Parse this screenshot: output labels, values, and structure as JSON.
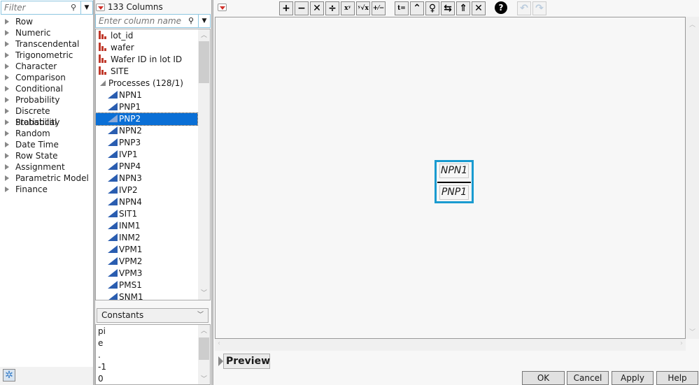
{
  "functions": {
    "filter_placeholder": "Filter",
    "categories": [
      "Row",
      "Numeric",
      "Transcendental",
      "Trigonometric",
      "Character",
      "Comparison",
      "Conditional",
      "Probability",
      "Discrete Probability",
      "Statistical",
      "Random",
      "Date Time",
      "Row State",
      "Assignment",
      "Parametric Model",
      "Finance"
    ]
  },
  "columns": {
    "header": "133 Columns",
    "search_placeholder": "Enter column name",
    "items": [
      {
        "label": "lot_id",
        "type": "nominal"
      },
      {
        "label": "wafer",
        "type": "nominal"
      },
      {
        "label": "Wafer ID in lot ID",
        "type": "nominal"
      },
      {
        "label": "SITE",
        "type": "nominal"
      },
      {
        "label": "Processes (128/1)",
        "type": "group"
      },
      {
        "label": "NPN1",
        "type": "continuous"
      },
      {
        "label": "PNP1",
        "type": "continuous"
      },
      {
        "label": "PNP2",
        "type": "continuous",
        "selected": true
      },
      {
        "label": "NPN2",
        "type": "continuous"
      },
      {
        "label": "PNP3",
        "type": "continuous"
      },
      {
        "label": "IVP1",
        "type": "continuous"
      },
      {
        "label": "PNP4",
        "type": "continuous"
      },
      {
        "label": "NPN3",
        "type": "continuous"
      },
      {
        "label": "IVP2",
        "type": "continuous"
      },
      {
        "label": "NPN4",
        "type": "continuous"
      },
      {
        "label": "SIT1",
        "type": "continuous"
      },
      {
        "label": "INM1",
        "type": "continuous"
      },
      {
        "label": "INM2",
        "type": "continuous"
      },
      {
        "label": "VPM1",
        "type": "continuous"
      },
      {
        "label": "VPM2",
        "type": "continuous"
      },
      {
        "label": "VPM3",
        "type": "continuous"
      },
      {
        "label": "PMS1",
        "type": "continuous"
      },
      {
        "label": "SNM1",
        "type": "continuous"
      }
    ]
  },
  "constants": {
    "selected": "Constants",
    "items": [
      "pi",
      "e",
      ".",
      "-1",
      "0"
    ]
  },
  "toolbar": {
    "buttons": [
      {
        "name": "add-button",
        "glyph": "+"
      },
      {
        "name": "subtract-button",
        "glyph": "−"
      },
      {
        "name": "multiply-button",
        "glyph": "✕"
      },
      {
        "name": "divide-button",
        "glyph": "÷"
      },
      {
        "name": "power-button",
        "glyph": "xʸ"
      },
      {
        "name": "root-button",
        "glyph": "ʸ√x"
      },
      {
        "name": "negate-button",
        "glyph": "+⁄−"
      },
      {
        "name": "local-variable-button",
        "glyph": "t="
      },
      {
        "name": "select-parent-button",
        "glyph": "⌃"
      },
      {
        "name": "peel-expression-button",
        "glyph": "♀"
      },
      {
        "name": "swap-button",
        "glyph": "⇆"
      },
      {
        "name": "unary-function-button",
        "glyph": "⇑"
      },
      {
        "name": "delete-button",
        "glyph": "✕"
      },
      {
        "name": "help-button",
        "glyph": "?"
      },
      {
        "name": "undo-button",
        "glyph": "↶"
      },
      {
        "name": "redo-button",
        "glyph": "↷"
      }
    ]
  },
  "formula": {
    "numerator": "NPN1",
    "denominator": "PNP1"
  },
  "preview_label": "Preview",
  "dialog_buttons": {
    "ok": "OK",
    "cancel": "Cancel",
    "apply": "Apply",
    "help": "Help"
  },
  "colors": {
    "selection": "#0a6fd6",
    "formula_border": "#1a9bd0",
    "nominal_icon": "#c0392b",
    "continuous_icon": "#2a5db0"
  }
}
